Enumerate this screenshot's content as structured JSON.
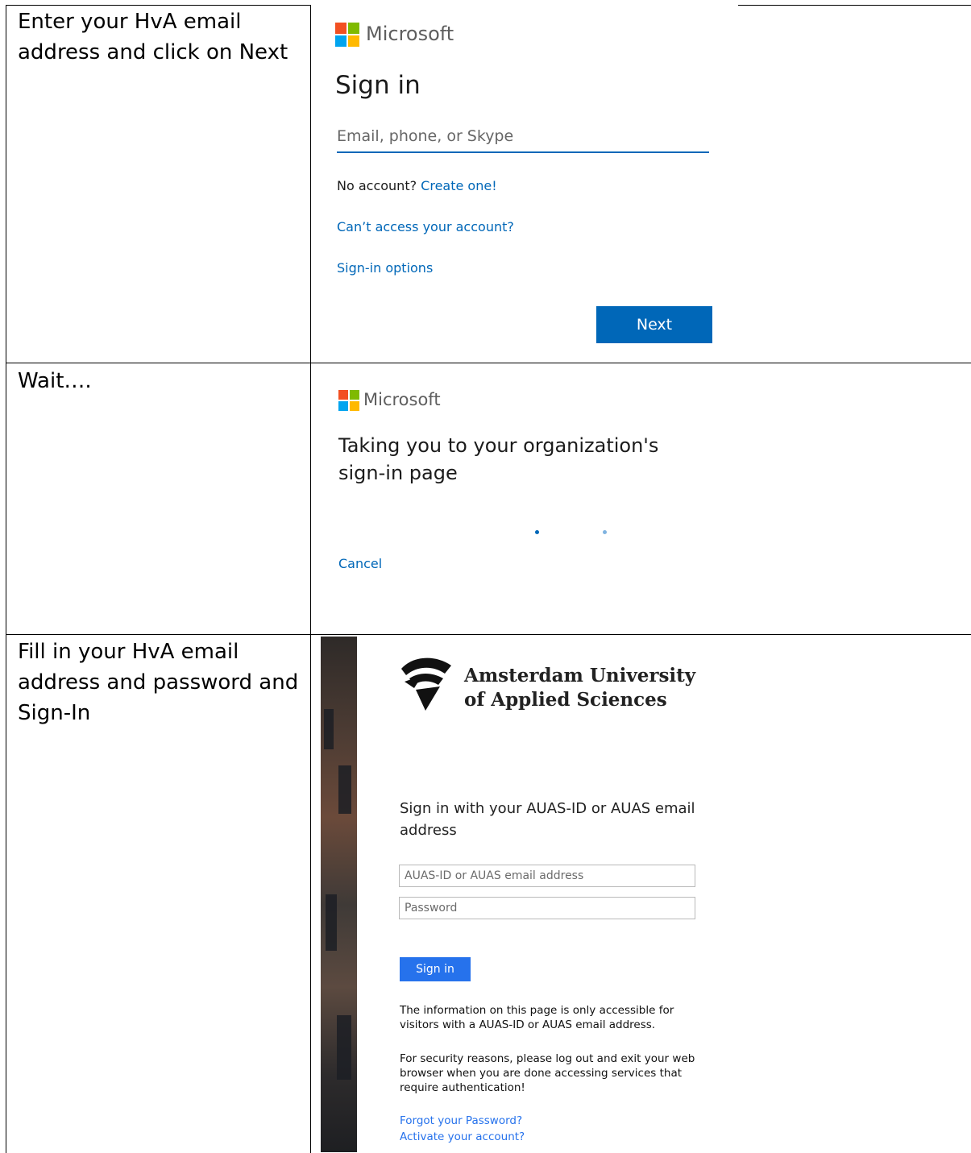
{
  "rows": [
    {
      "instruction": "Enter your HvA email address and click on Next"
    },
    {
      "instruction": "Wait…."
    },
    {
      "instruction": "Fill in your HvA email address and password and Sign-In"
    }
  ],
  "microsoft_signin": {
    "brand": "Microsoft",
    "title": "Sign in",
    "email_placeholder": "Email, phone, or Skype",
    "no_account_text": "No account?",
    "create_link": "Create one!",
    "cant_access_link": "Can’t access your account?",
    "signin_options_link": "Sign-in options",
    "next_button": "Next"
  },
  "redirect": {
    "brand": "Microsoft",
    "title": "Taking you to your organization's sign-in page",
    "cancel_link": "Cancel"
  },
  "auas": {
    "org_line1": "Amsterdam University",
    "org_line2": "of Applied Sciences",
    "intro": "Sign in with your AUAS-ID or AUAS email address",
    "id_placeholder": "AUAS-ID or AUAS email address",
    "password_placeholder": "Password",
    "signin_button": "Sign in",
    "info_text": "The information on this page is only accessible for visitors with a AUAS-ID or AUAS email address.",
    "security_text": "For security reasons, please log out and exit your web browser when you are done accessing services that require authentication!",
    "forgot_link": "Forgot your Password?",
    "activate_link": "Activate your account?"
  },
  "colors": {
    "ms_red": "#f25022",
    "ms_green": "#7fba00",
    "ms_blue": "#00a4ef",
    "ms_yellow": "#ffb900",
    "ms_accent": "#0067b8",
    "auas_accent": "#2672ec"
  }
}
